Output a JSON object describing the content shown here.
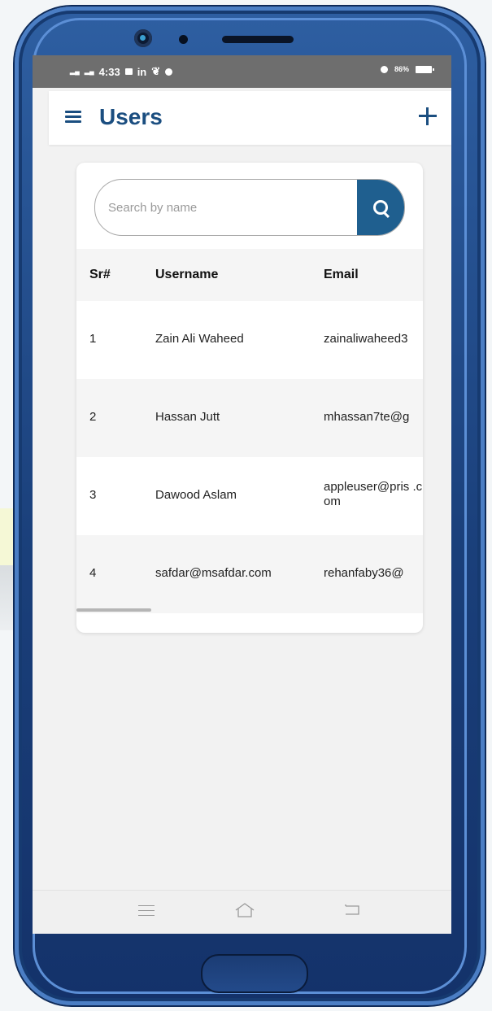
{
  "statusbar": {
    "time": "4:33",
    "carrier_icons": [
      "signal-icon",
      "signal-icon"
    ],
    "notifications": [
      "message-icon",
      "linkedin-icon",
      "leaf-icon",
      "info-icon"
    ],
    "battery": "86%"
  },
  "appbar": {
    "title": "Users",
    "menu_icon": "hamburger-icon",
    "add_icon": "plus-icon"
  },
  "search": {
    "placeholder": "Search by name",
    "value": "",
    "icon": "search-icon"
  },
  "table": {
    "headers": [
      "Sr#",
      "Username",
      "Email"
    ],
    "rows": [
      {
        "sr": "1",
        "username": "Zain Ali Waheed",
        "email": "zainaliwaheed3"
      },
      {
        "sr": "2",
        "username": "Hassan Jutt",
        "email": "mhassan7te@g"
      },
      {
        "sr": "3",
        "username": "Dawood Aslam",
        "email": "appleuser@pris .com"
      },
      {
        "sr": "4",
        "username": "safdar@msafdar.com",
        "email": "rehanfaby36@"
      }
    ]
  },
  "colors": {
    "primary": "#1b4e80",
    "search_button": "#1f5f8f",
    "statusbar": "#6e6e6e",
    "phone_frame": "#1f4a8a"
  },
  "navbar": {
    "icons": [
      "menu-icon",
      "home-icon",
      "back-icon"
    ]
  }
}
